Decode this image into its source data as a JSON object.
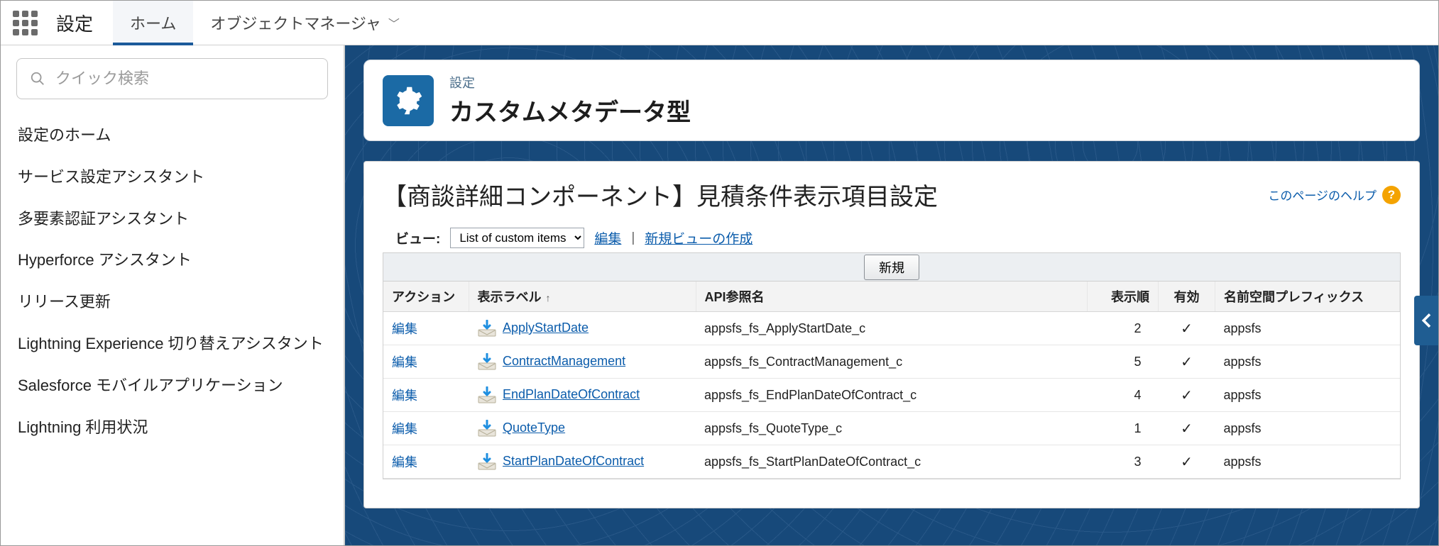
{
  "topbar": {
    "app_title": "設定",
    "tab_home": "ホーム",
    "tab_obj": "オブジェクトマネージャ"
  },
  "sidebar": {
    "search_placeholder": "クイック検索",
    "items": [
      "設定のホーム",
      "サービス設定アシスタント",
      "多要素認証アシスタント",
      "Hyperforce アシスタント",
      "リリース更新",
      "Lightning Experience 切り替えアシスタント",
      "Salesforce モバイルアプリケーション",
      "Lightning 利用状況"
    ]
  },
  "header": {
    "sup": "設定",
    "title": "カスタムメタデータ型"
  },
  "body": {
    "title": "【商談詳細コンポーネント】見積条件表示項目設定",
    "help": "このページのヘルプ",
    "view_label": "ビュー:",
    "view_select": "List of custom items",
    "view_edit": "編集",
    "view_new": "新規ビューの作成",
    "new_button": "新規",
    "cols": {
      "action": "アクション",
      "label": "表示ラベル",
      "api": "API参照名",
      "order": "表示順",
      "active": "有効",
      "ns": "名前空間プレフィックス"
    },
    "action_edit": "編集",
    "rows": [
      {
        "label": "ApplyStartDate",
        "api": "appsfs_fs_ApplyStartDate_c",
        "order": "2",
        "active": "✓",
        "ns": "appsfs"
      },
      {
        "label": "ContractManagement",
        "api": "appsfs_fs_ContractManagement_c",
        "order": "5",
        "active": "✓",
        "ns": "appsfs"
      },
      {
        "label": "EndPlanDateOfContract",
        "api": "appsfs_fs_EndPlanDateOfContract_c",
        "order": "4",
        "active": "✓",
        "ns": "appsfs"
      },
      {
        "label": "QuoteType",
        "api": "appsfs_fs_QuoteType_c",
        "order": "1",
        "active": "✓",
        "ns": "appsfs"
      },
      {
        "label": "StartPlanDateOfContract",
        "api": "appsfs_fs_StartPlanDateOfContract_c",
        "order": "3",
        "active": "✓",
        "ns": "appsfs"
      }
    ]
  }
}
